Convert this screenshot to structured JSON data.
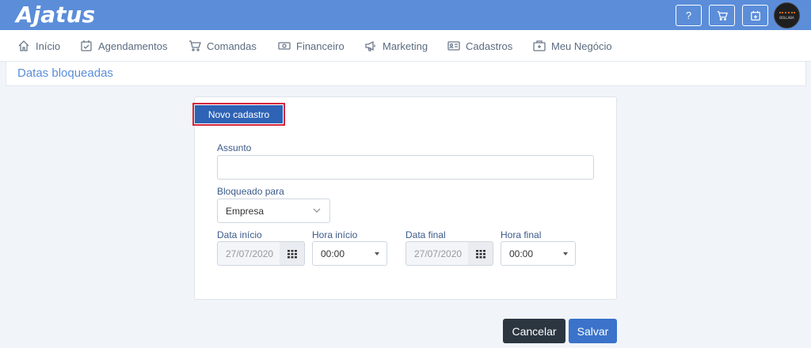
{
  "app": {
    "logo_text": "Ajatus"
  },
  "topbar": {
    "help_label": "?",
    "avatar_text": "BOLLABA"
  },
  "nav": {
    "items": [
      {
        "label": "Início",
        "icon": "home-icon"
      },
      {
        "label": "Agendamentos",
        "icon": "calendar-check-icon"
      },
      {
        "label": "Comandas",
        "icon": "cart-icon"
      },
      {
        "label": "Financeiro",
        "icon": "money-icon"
      },
      {
        "label": "Marketing",
        "icon": "megaphone-icon"
      },
      {
        "label": "Cadastros",
        "icon": "id-card-icon"
      },
      {
        "label": "Meu Negócio",
        "icon": "briefcase-icon"
      }
    ]
  },
  "page": {
    "title": "Datas bloqueadas"
  },
  "form": {
    "novo_label": "Novo cadastro",
    "assunto_label": "Assunto",
    "assunto_value": "",
    "bloqueado_label": "Bloqueado para",
    "bloqueado_value": "Empresa",
    "data_inicio_label": "Data início",
    "data_inicio_value": "27/07/2020",
    "hora_inicio_label": "Hora início",
    "hora_inicio_value": "00:00",
    "data_final_label": "Data final",
    "data_final_value": "27/07/2020",
    "hora_final_label": "Hora final",
    "hora_final_value": "00:00"
  },
  "actions": {
    "cancel_label": "Cancelar",
    "save_label": "Salvar"
  },
  "colors": {
    "topbar": "#5b8dd9",
    "primary": "#2e63b5",
    "highlight": "#d6263a",
    "cancel": "#2b3640"
  }
}
